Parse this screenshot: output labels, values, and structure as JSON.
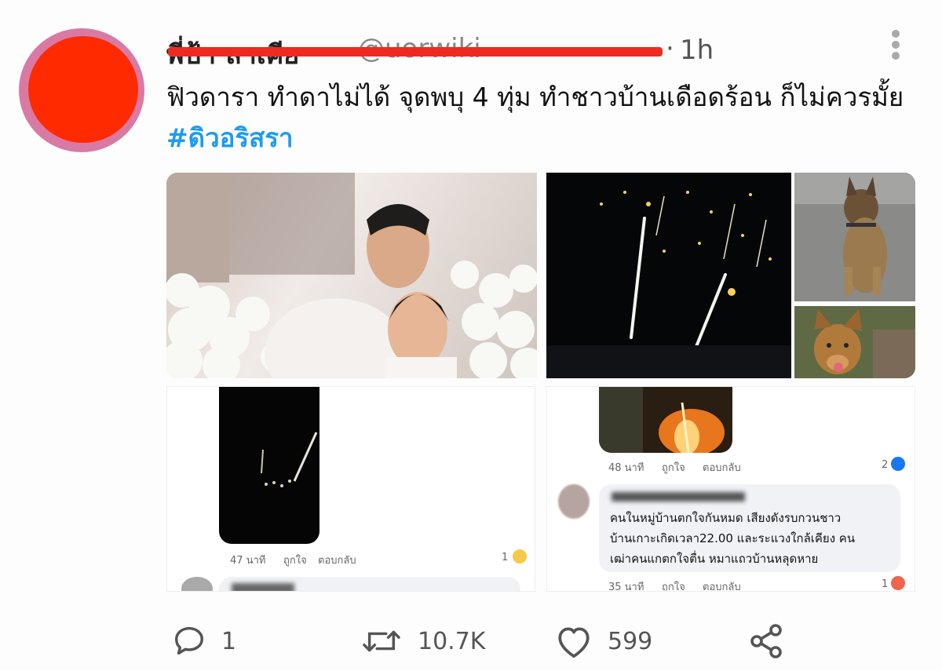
{
  "tweet": {
    "author_name": "พี่ป้า ลาเคีย",
    "author_handle": "@uorwiki",
    "time_separator": "·",
    "time": "1h",
    "text": "ฟิวดารา ทำดาไม่ได้ จุดพบุ 4 ทุ่ม ทำชาวบ้านเดือดร้อน ก็ไม่ควรมั้ย",
    "hashtag": "#ดิวอริสรา"
  },
  "screenshot_left": {
    "time": "47 นาที",
    "like": "ถูกใจ",
    "reply": "ตอบกลับ",
    "reaction_count": "1"
  },
  "screenshot_right": {
    "time": "48 นาที",
    "like": "ถูกใจ",
    "reply": "ตอบกลับ",
    "reaction_count": "2",
    "comment_line1": "คนในหมู่บ้านตกใจกันหมด เสียงดังรบกวนชาว",
    "comment_line2": "บ้านเกาะเกิดเวลา22.00 และระแวงใกล้เคียง คน",
    "comment_line3": "เฒ่าคนแกตกใจตื่น หมาแถวบ้านหลุดหาย",
    "time2": "35 นาที",
    "like2": "ถูกใจ",
    "reply2": "ตอบกลับ",
    "reaction_count2": "1"
  },
  "actions": {
    "reply_count": "1",
    "retweet_count": "10.7K",
    "like_count": "599"
  },
  "icons": {
    "reply": "reply-icon",
    "retweet": "retweet-icon",
    "like": "heart-icon",
    "share": "share-icon",
    "more": "more-vertical-icon"
  },
  "colors": {
    "hashtag": "#1d9bf0",
    "redaction": "#ef2b21",
    "avatar_fill": "#ff2a00",
    "avatar_ring": "#d97aa4"
  }
}
